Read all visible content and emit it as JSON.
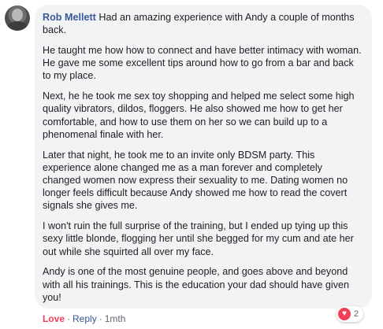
{
  "comment": {
    "author": "Rob Mellett",
    "paragraphs": [
      "Had an amazing experience with Andy a couple of months back.",
      "He taught me how how to connect and have better intimacy with woman. He gave me some excellent tips around how to go from a bar and back to my place.",
      "Next, he he took me sex toy shopping and helped me select some high quality vibrators, dildos, floggers. He also showed me how to get her comfortable, and how to use them on her so we can build up to a phenomenal finale with her.",
      "Later that night, he took me to an invite only BDSM party. This experience alone changed me as a man forever and completely changed women now express their sexuality to me. Dating women no longer feels difficult because Andy showed me how to read the covert signals she gives me.",
      "I won't ruin the full surprise of the training, but I ended up tying up this sexy little blonde, flogging her until she begged for my cum and ate her out while she squirted all over my face.",
      "Andy is one of the most genuine people, and goes above and beyond with all his trainings. This is the education your dad should have given you!"
    ],
    "reaction_count": "2",
    "reaction_icon": "heart-icon"
  },
  "actions": {
    "love_label": "Love",
    "separator": "·",
    "reply_label": "Reply",
    "timestamp": "1mth"
  },
  "colors": {
    "author": "#385898",
    "bubble_bg": "#f2f3f5",
    "love": "#f33e58",
    "meta": "#606770"
  }
}
